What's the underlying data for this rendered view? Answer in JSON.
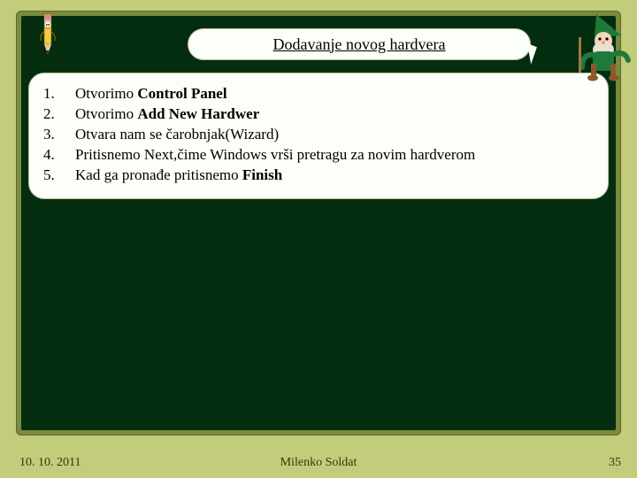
{
  "title": "Dodavanje novog hardvera",
  "list": [
    {
      "num": "1.",
      "pre": "Otvorimo ",
      "bold": "Control Panel",
      "post": ""
    },
    {
      "num": "2.",
      "pre": "Otvorimo ",
      "bold": "Add New Hardwer",
      "post": ""
    },
    {
      "num": "3.",
      "pre": "Otvara nam se čarobnjak(Wizard)",
      "bold": "",
      "post": ""
    },
    {
      "num": "4.",
      "pre": "Pritisnemo Next,čime Windows vrši pretragu za novim hardverom",
      "bold": "",
      "post": ""
    },
    {
      "num": "5.",
      "pre": "Kad ga pronađe pritisnemo ",
      "bold": "Finish",
      "post": ""
    }
  ],
  "footer": {
    "date": "10. 10. 2011",
    "author": "Milenko Soldat",
    "page": "35"
  }
}
